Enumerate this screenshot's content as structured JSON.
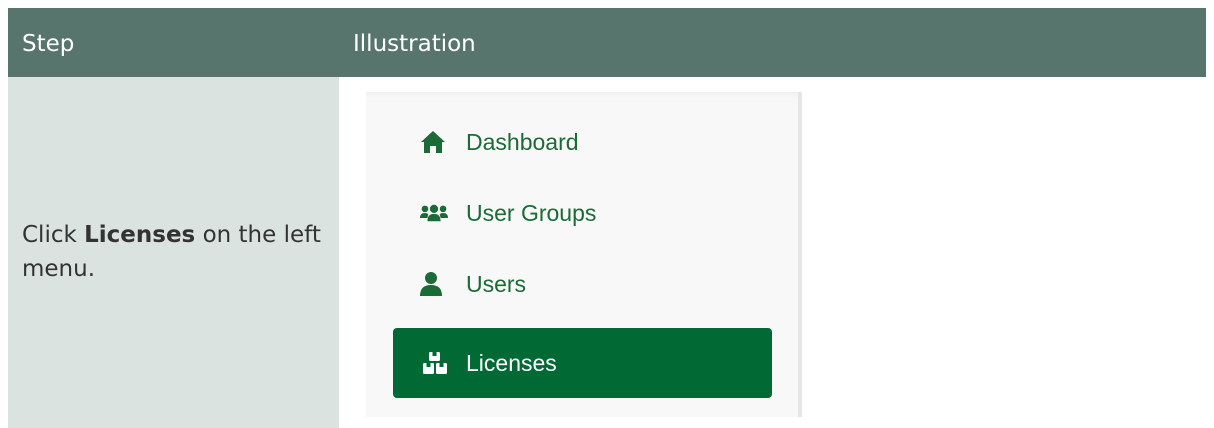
{
  "table": {
    "header": {
      "step": "Step",
      "illustration": "Illustration"
    },
    "row": {
      "instruction_prefix": "Click ",
      "instruction_bold": "Licenses",
      "instruction_suffix": " on the left menu."
    }
  },
  "menu": {
    "items": [
      {
        "label": "Dashboard",
        "icon": "home-icon"
      },
      {
        "label": "User Groups",
        "icon": "user-groups-icon"
      },
      {
        "label": "Users",
        "icon": "user-icon"
      },
      {
        "label": "Licenses",
        "icon": "licenses-icon",
        "active": true
      }
    ]
  },
  "colors": {
    "header_bg": "#58756d",
    "step_cell_bg": "#dbe3e1",
    "menu_text": "#1a6b36",
    "active_bg": "#006934"
  }
}
